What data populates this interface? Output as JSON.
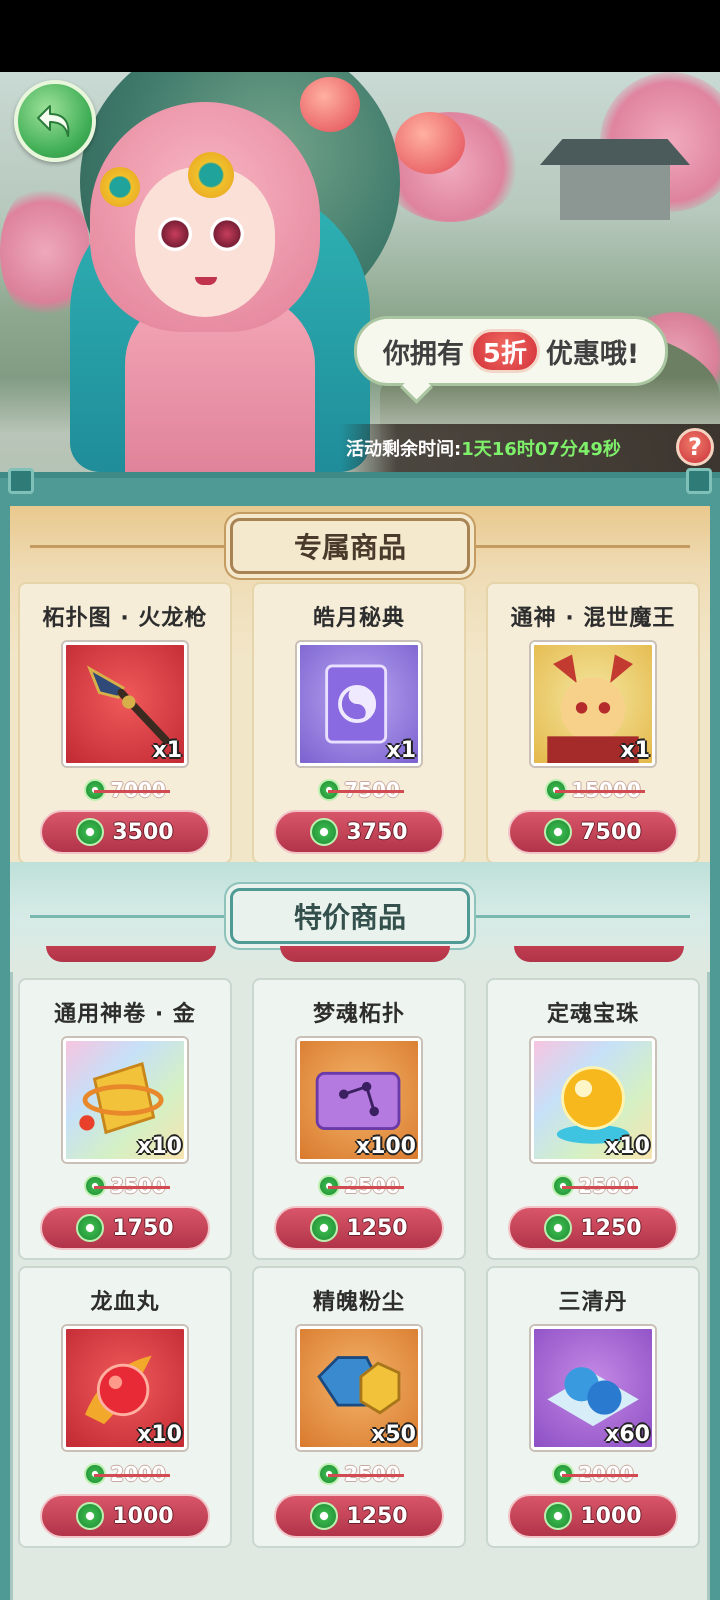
{
  "banner": {
    "discount_prefix": "你拥有",
    "discount_value": "5折",
    "discount_suffix": "优惠哦!",
    "timer_label": "活动剩余时间:",
    "timer_value": "1天16时07分49秒",
    "help_symbol": "?"
  },
  "sections": {
    "exclusive_title": "专属商品",
    "special_title": "特价商品"
  },
  "exclusive_items": [
    {
      "name": "柘扑图 · 火龙枪",
      "qty": "x1",
      "old_price": "7000",
      "price": "3500",
      "bg": "red"
    },
    {
      "name": "皓月秘典",
      "qty": "x1",
      "old_price": "7500",
      "price": "3750",
      "bg": "purple"
    },
    {
      "name": "通神 · 混世魔王",
      "qty": "x1",
      "old_price": "15000",
      "price": "7500",
      "bg": "gold"
    }
  ],
  "special_items": [
    {
      "name": "通用神卷 · 金",
      "qty": "x10",
      "old_price": "3500",
      "price": "1750",
      "bg": "rainbow"
    },
    {
      "name": "梦魂柘扑",
      "qty": "x100",
      "old_price": "2500",
      "price": "1250",
      "bg": "orange"
    },
    {
      "name": "定魂宝珠",
      "qty": "x10",
      "old_price": "2500",
      "price": "1250",
      "bg": "rainbow"
    },
    {
      "name": "龙血丸",
      "qty": "x10",
      "old_price": "2000",
      "price": "1000",
      "bg": "red"
    },
    {
      "name": "精魄粉尘",
      "qty": "x50",
      "old_price": "2500",
      "price": "1250",
      "bg": "orange"
    },
    {
      "name": "三清丹",
      "qty": "x60",
      "old_price": "2000",
      "price": "1000",
      "bg": "violet"
    }
  ],
  "icons": {
    "currency": "jade-coin-icon",
    "back": "back-arrow-icon",
    "help": "question-icon"
  },
  "colors": {
    "price_button": "#b23448",
    "timer_value": "#7ef06a",
    "panel": "#4f9a94"
  }
}
